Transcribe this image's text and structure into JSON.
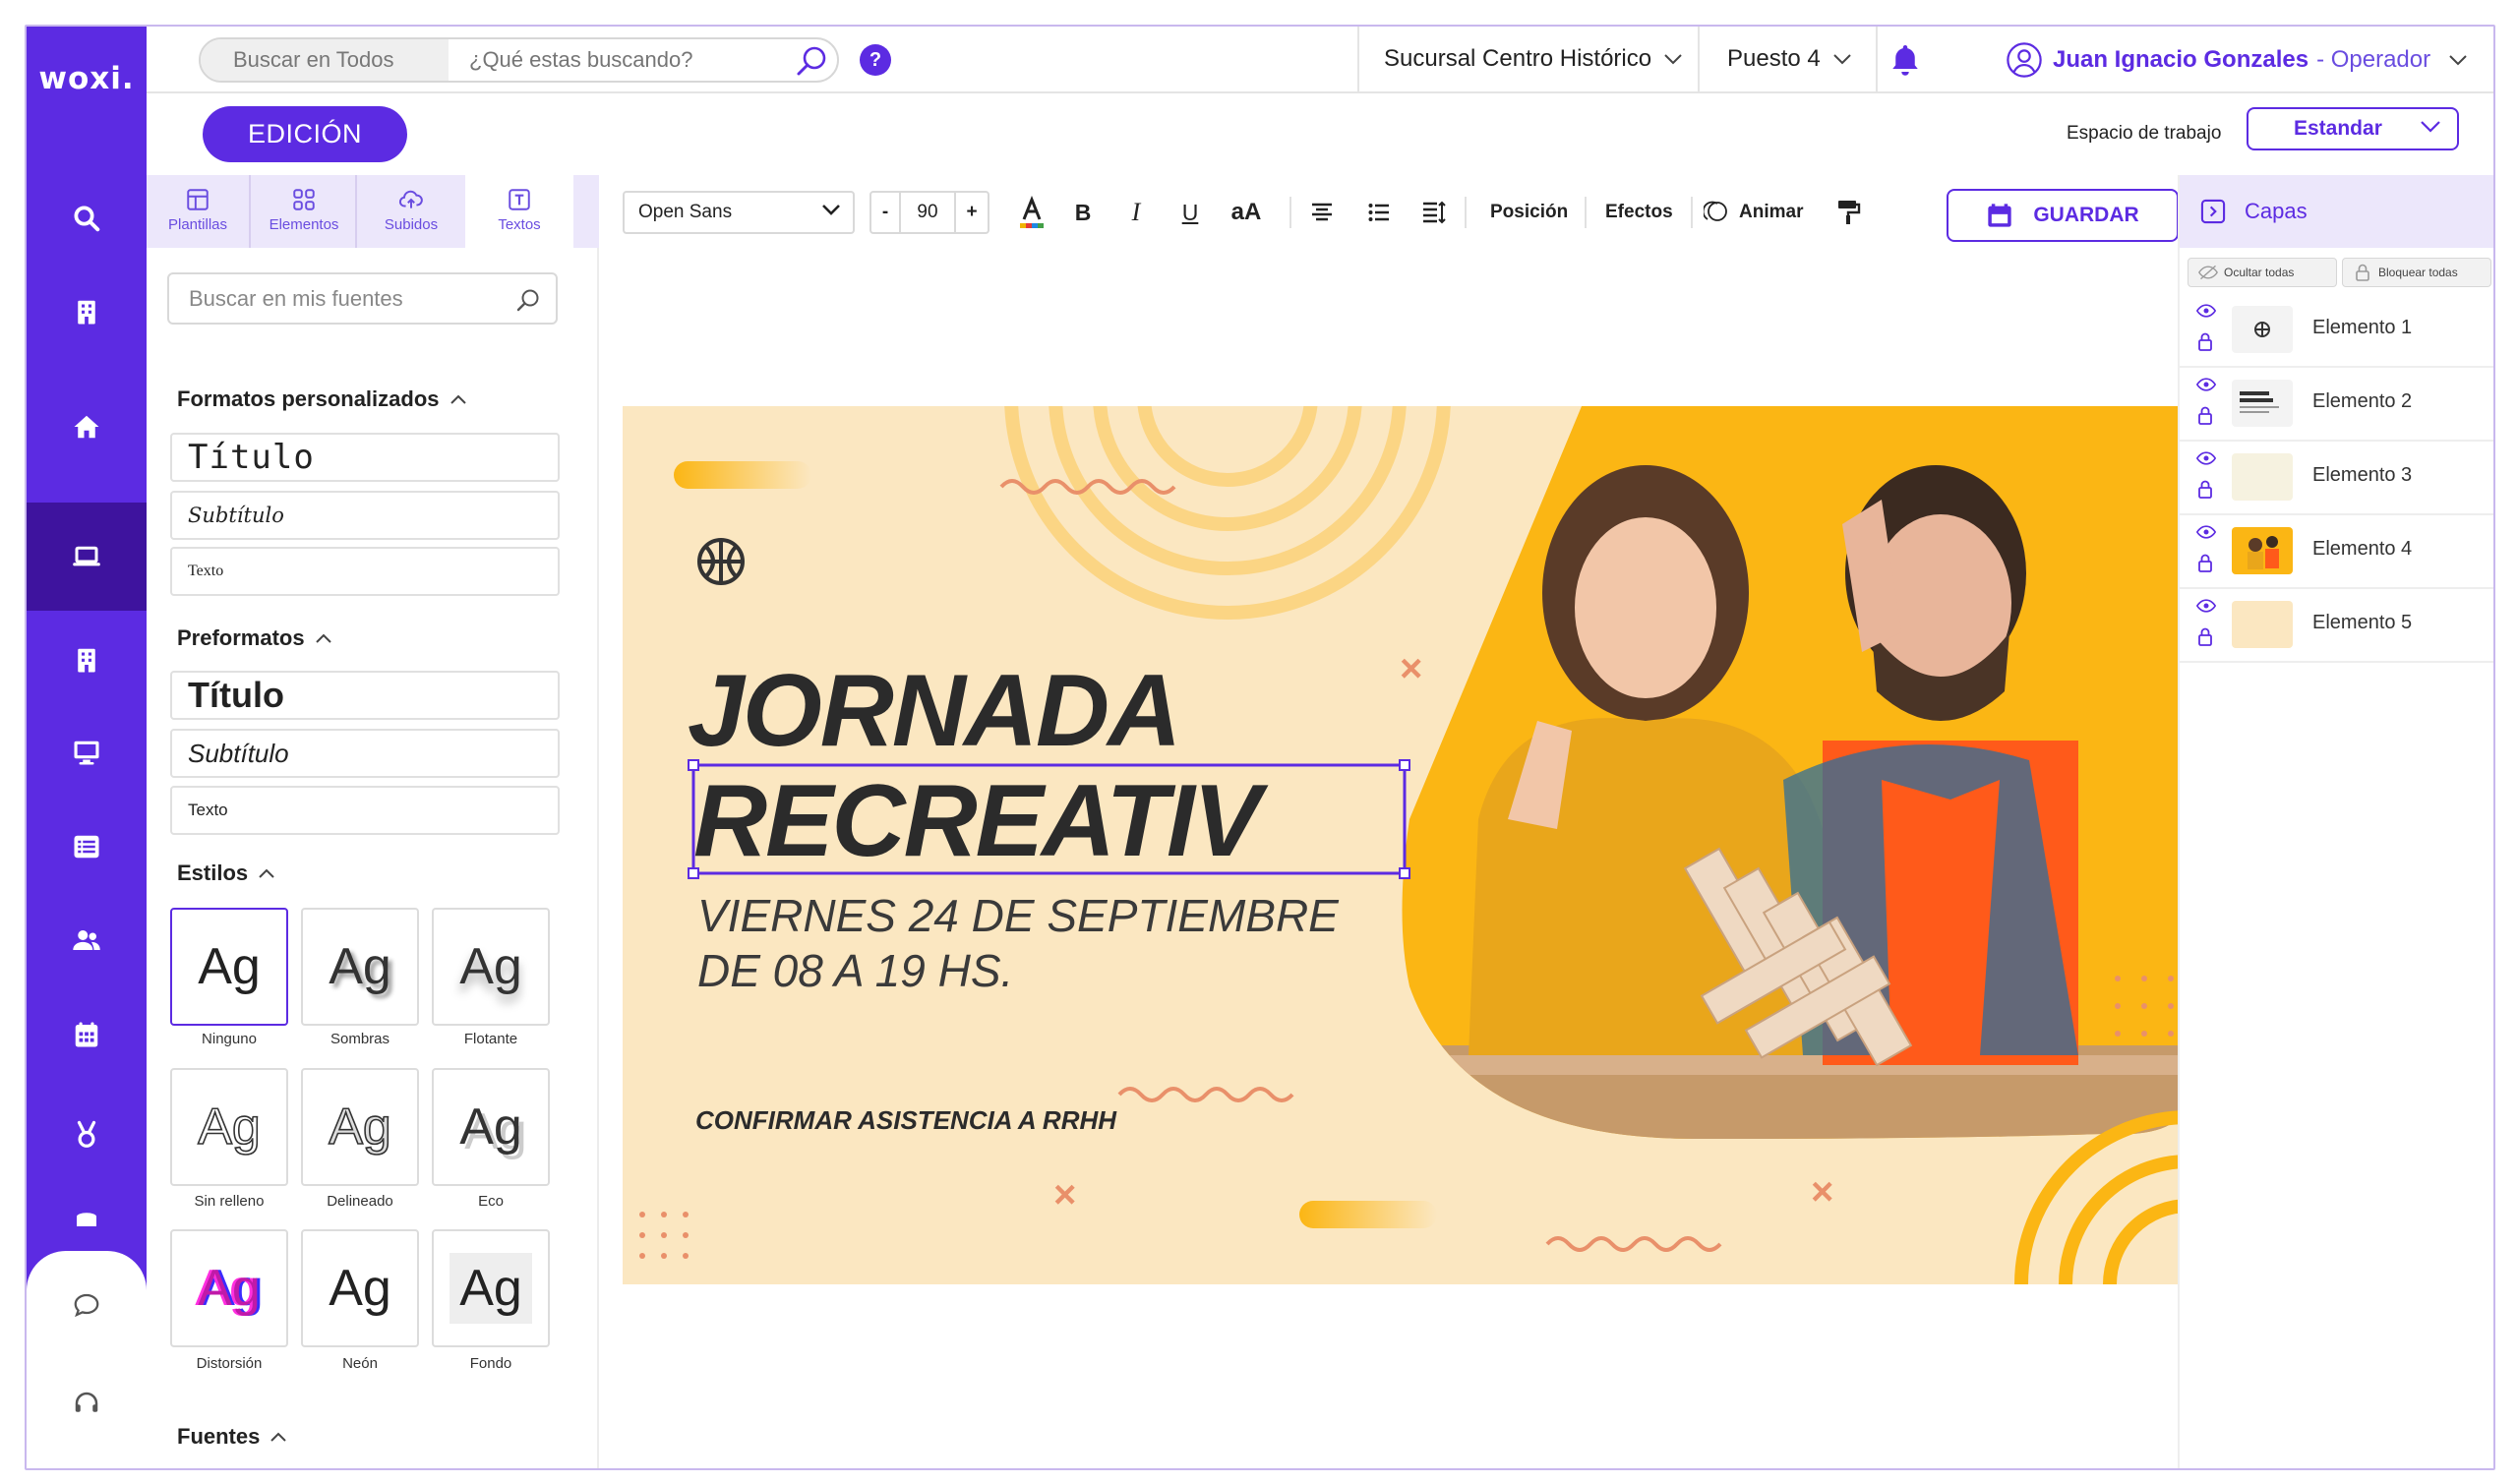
{
  "brand": {
    "logo": "woxi.",
    "accent": "#5c2be2",
    "accent_dark": "#3e139e",
    "light": "#ece7fb"
  },
  "rail": {
    "items": [
      "search-icon",
      "building-icon",
      "home-icon",
      "laptop-icon",
      "building-icon",
      "monitor-icon",
      "list-icon",
      "users-icon",
      "calendar-icon",
      "medal-icon",
      "coins-icon",
      "chat-icon",
      "headset-icon"
    ],
    "active": "laptop-icon"
  },
  "header": {
    "search_scope": "Buscar en Todos",
    "search_placeholder": "¿Qué estas buscando?",
    "help": "?",
    "branch": "Sucursal Centro Histórico",
    "post": "Puesto 4",
    "user_name": "Juan Ignacio Gonzales",
    "user_role": "- Operador"
  },
  "subbar": {
    "edit_label": "EDICIÓN",
    "workspace_label": "Espacio de trabajo",
    "workspace_value": "Estandar"
  },
  "panel": {
    "tabs": [
      {
        "label": "Plantillas",
        "icon": "template-icon"
      },
      {
        "label": "Elementos",
        "icon": "grid-icon"
      },
      {
        "label": "Subidos",
        "icon": "upload-cloud-icon"
      },
      {
        "label": "Textos",
        "icon": "text-icon"
      }
    ],
    "active_tab": "Textos",
    "search_placeholder": "Buscar en mis fuentes",
    "custom_title": "Formatos personalizados",
    "custom": [
      "Título",
      "Subtítulo",
      "Texto"
    ],
    "pre_title": "Preformatos",
    "pre": [
      "Título",
      "Subtítulo",
      "Texto"
    ],
    "styles_title": "Estilos",
    "sample": "Ag",
    "styles": [
      "Ninguno",
      "Sombras",
      "Flotante",
      "Sin relleno",
      "Delineado",
      "Eco",
      "Distorsión",
      "Neón",
      "Fondo"
    ],
    "fonts_title": "Fuentes"
  },
  "toolbar": {
    "font": "Open Sans",
    "minus": "-",
    "size": "90",
    "plus": "+",
    "bold": "B",
    "italic": "I",
    "underline": "U",
    "case": "aA",
    "position": "Posición",
    "effects": "Efectos",
    "animate": "Animar",
    "save": "GUARDAR"
  },
  "canvas": {
    "title_line1": "JORNADA",
    "title_line2": "RECREATIV",
    "date_line1": "VIERNES 24 DE SEPTIEMBRE",
    "date_line2": "DE 08 A 19 HS.",
    "rsvp": "CONFIRMAR ASISTENCIA A RRHH",
    "cross": "×",
    "bg_color": "#fbe7c1",
    "accent_color": "#fbb614"
  },
  "layers": {
    "title": "Capas",
    "hide_all": "Ocultar todas",
    "lock_all": "Bloquear todas",
    "items": [
      "Elemento 1",
      "Elemento 2",
      "Elemento 3",
      "Elemento 4",
      "Elemento 5"
    ]
  }
}
